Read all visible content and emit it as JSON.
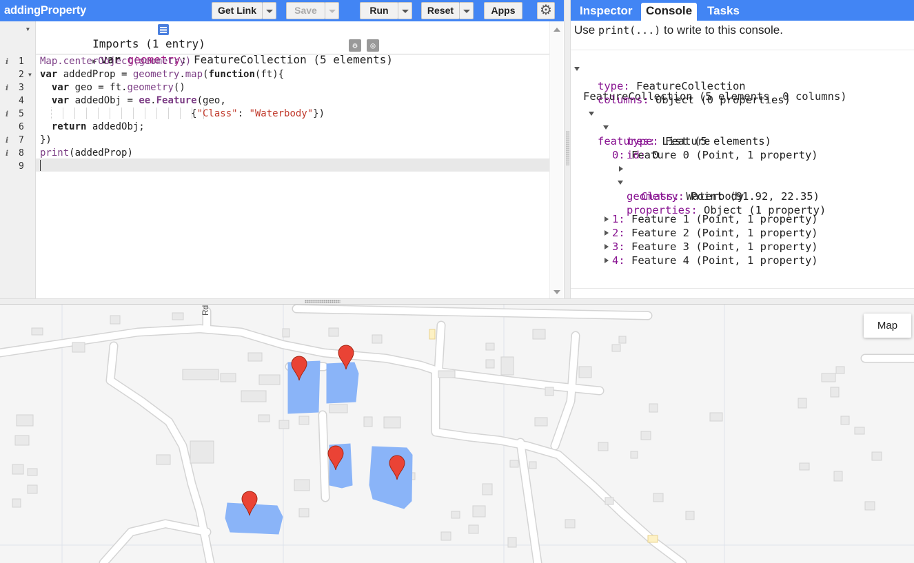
{
  "toolbar": {
    "script_title": "addingProperty",
    "get_link": "Get Link",
    "save": "Save",
    "run": "Run",
    "reset": "Reset",
    "apps": "Apps",
    "gear_icon": "gear-icon"
  },
  "imports": {
    "header": "Imports (1 entry)",
    "decl_kw": "var",
    "decl_name": "geometry",
    "decl_value": ": FeatureCollection (5 elements)"
  },
  "code": {
    "line_numbers": [
      "1",
      "2",
      "3",
      "4",
      "5",
      "6",
      "7",
      "8",
      "9"
    ],
    "lines": [
      {
        "parts": [
          {
            "t": "Map.",
            "c": "c-fn"
          },
          {
            "t": "centerObject",
            "c": "c-fn"
          },
          {
            "t": "(",
            "c": "c-fn"
          },
          {
            "t": "geometry",
            "c": "c-fn"
          },
          {
            "t": ")",
            "c": "c-fn"
          }
        ]
      },
      {
        "parts": [
          {
            "t": "var",
            "c": "c-kw"
          },
          {
            "t": " addedProp = ",
            "c": ""
          },
          {
            "t": "geometry",
            "c": "c-prop"
          },
          {
            "t": ".",
            "c": ""
          },
          {
            "t": "map",
            "c": "c-prop"
          },
          {
            "t": "(",
            "c": ""
          },
          {
            "t": "function",
            "c": "c-kw"
          },
          {
            "t": "(ft){",
            "c": ""
          }
        ]
      },
      {
        "parts": [
          {
            "t": "  var",
            "c": "c-kw"
          },
          {
            "t": " geo = ft.",
            "c": ""
          },
          {
            "t": "geometry",
            "c": "c-prop"
          },
          {
            "t": "()",
            "c": ""
          }
        ]
      },
      {
        "parts": [
          {
            "t": "  var",
            "c": "c-kw"
          },
          {
            "t": " addedObj = ",
            "c": ""
          },
          {
            "t": "ee",
            "c": "c-ee"
          },
          {
            "t": ".",
            "c": ""
          },
          {
            "t": "Feature",
            "c": "c-ee"
          },
          {
            "t": "(geo,",
            "c": ""
          }
        ]
      },
      {
        "parts": [
          {
            "t": "                          {",
            "c": ""
          },
          {
            "t": "\"Class\"",
            "c": "c-str"
          },
          {
            "t": ": ",
            "c": ""
          },
          {
            "t": "\"Waterbody\"",
            "c": "c-str"
          },
          {
            "t": "})",
            "c": ""
          }
        ]
      },
      {
        "parts": [
          {
            "t": "  return",
            "c": "c-kw"
          },
          {
            "t": " addedObj;",
            "c": ""
          }
        ]
      },
      {
        "parts": [
          {
            "t": "})",
            "c": ""
          }
        ]
      },
      {
        "parts": [
          {
            "t": "print",
            "c": "c-fn"
          },
          {
            "t": "(addedProp)",
            "c": ""
          }
        ]
      },
      {
        "parts": []
      }
    ]
  },
  "tabs": {
    "inspector": "Inspector",
    "console": "Console",
    "tasks": "Tasks"
  },
  "console": {
    "hint_pre": "Use ",
    "hint_code": "print(...)",
    "hint_post": " to write to this console.",
    "collection": "FeatureCollection (5 elements, 0 columns)",
    "type_key": "type:",
    "type_val": " FeatureCollection",
    "columns_key": "columns:",
    "columns_val": " Object (0 properties)",
    "features_key": "features:",
    "features_val": " List (5 elements)",
    "f0_key": "0:",
    "f0_val": " Feature 0 (Point, 1 property)",
    "f0_type_key": "type:",
    "f0_type_val": " Feature",
    "f0_id_key": "id:",
    "f0_id_val": " 0",
    "f0_geom_key": "geometry:",
    "f0_geom_val": " Point (91.92, 22.35)",
    "f0_props_key": "properties:",
    "f0_props_val": " Object (1 property)",
    "f0_class_key": "Class:",
    "f0_class_val": " Waterbody",
    "others": [
      {
        "key": "1:",
        "val": " Feature 1 (Point, 1 property)"
      },
      {
        "key": "2:",
        "val": " Feature 2 (Point, 1 property)"
      },
      {
        "key": "3:",
        "val": " Feature 3 (Point, 1 property)"
      },
      {
        "key": "4:",
        "val": " Feature 4 (Point, 1 property)"
      }
    ]
  },
  "map": {
    "map_type_button": "Map",
    "road_label": "Rd",
    "water_color": "#8ab4f8",
    "marker_color": "#ea4335",
    "marker_count": 5
  }
}
